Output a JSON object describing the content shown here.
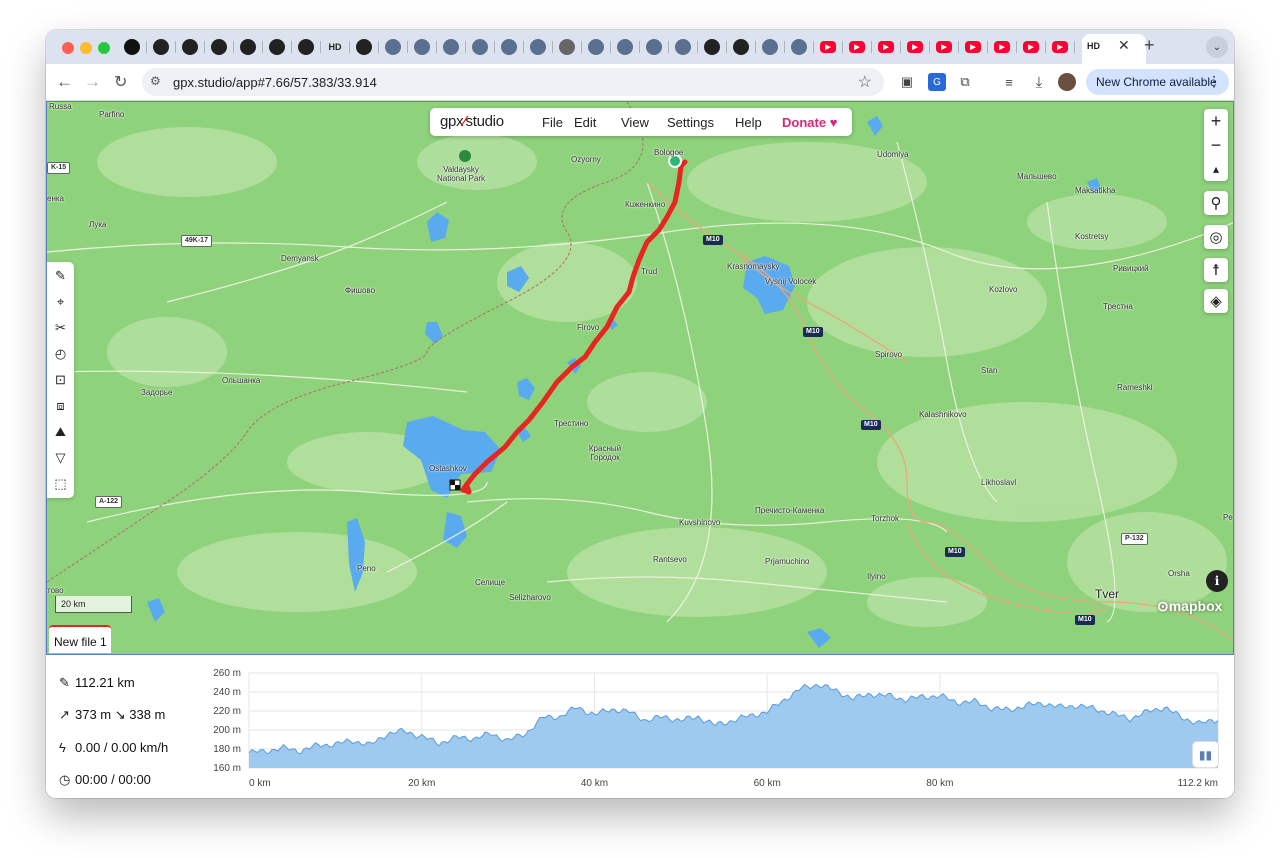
{
  "browser": {
    "url": "gpx.studio/app#7.66/57.383/33.914",
    "active_tab_badge": "HD",
    "hd_badge": "HD",
    "update_button": "New Chrome available",
    "tab_icons": [
      "openai",
      "github",
      "github",
      "github",
      "github",
      "github",
      "github",
      "hd",
      "github",
      "app",
      "app",
      "app",
      "app",
      "app",
      "app",
      "wikipedia",
      "app",
      "app",
      "app",
      "app",
      "github",
      "github",
      "app",
      "app",
      "youtube",
      "youtube",
      "youtube",
      "youtube",
      "youtube",
      "youtube",
      "youtube",
      "youtube",
      "youtube",
      "hd"
    ]
  },
  "app": {
    "logo_left": "gpx",
    "logo_right": "studio",
    "menu": [
      "File",
      "Edit",
      "View",
      "Settings",
      "Help"
    ],
    "donate": "Donate",
    "new_file_tab": "New file 1",
    "scale_label": "20 km",
    "mapbox_label": "mapbox"
  },
  "map": {
    "places": [
      {
        "name": "Russa",
        "big": false
      },
      {
        "name": "Parfino",
        "big": false
      },
      {
        "name": "Valdaysky National Park",
        "big": false
      },
      {
        "name": "Ozyorny",
        "big": false
      },
      {
        "name": "Bologoe",
        "big": false
      },
      {
        "name": "Udomlya",
        "big": false
      },
      {
        "name": "Мальшево",
        "big": false
      },
      {
        "name": "Maksatikha",
        "big": false
      },
      {
        "name": "Кuженкино",
        "big": false
      },
      {
        "name": "Лука",
        "big": false
      },
      {
        "name": "Demyansk",
        "big": false
      },
      {
        "name": "Фишово",
        "big": false
      },
      {
        "name": "Trud",
        "big": false
      },
      {
        "name": "Krasnomaysky",
        "big": false
      },
      {
        "name": "Vysnij Volocek",
        "big": false
      },
      {
        "name": "Kostretsy",
        "big": false
      },
      {
        "name": "Ривицкий",
        "big": false
      },
      {
        "name": "Kozlovo",
        "big": false
      },
      {
        "name": "Трестна",
        "big": false
      },
      {
        "name": "Firovo",
        "big": false
      },
      {
        "name": "Spirovo",
        "big": false
      },
      {
        "name": "Stan",
        "big": false
      },
      {
        "name": "Ольшанка",
        "big": false
      },
      {
        "name": "Задорье",
        "big": false
      },
      {
        "name": "Rameshki",
        "big": false
      },
      {
        "name": "Трестино",
        "big": false
      },
      {
        "name": "Kalashnikovo",
        "big": false
      },
      {
        "name": "Красный Городок",
        "big": false
      },
      {
        "name": "Ostashkov",
        "big": false
      },
      {
        "name": "Likhoslavl",
        "big": false
      },
      {
        "name": "Kuvshinovo",
        "big": false
      },
      {
        "name": "Пречисто-Каменка",
        "big": false
      },
      {
        "name": "Torzhok",
        "big": false
      },
      {
        "name": "Rantsevo",
        "big": false
      },
      {
        "name": "Prjamuchino",
        "big": false
      },
      {
        "name": "Ilyino",
        "big": false
      },
      {
        "name": "Peno",
        "big": false
      },
      {
        "name": "Селище",
        "big": false
      },
      {
        "name": "Selizharovo",
        "big": false
      },
      {
        "name": "Orsha",
        "big": false
      },
      {
        "name": "Tver",
        "big": true
      },
      {
        "name": "тово",
        "big": false
      },
      {
        "name": "енка",
        "big": false
      },
      {
        "name": "Pe",
        "big": false
      }
    ],
    "road_shields": [
      "K-15",
      "49K-17",
      "M10",
      "M10",
      "M10",
      "M10",
      "A-122",
      "P-132",
      "M10"
    ]
  },
  "stats": {
    "distance": "112.21 km",
    "elevation": "373 m ↘ 338 m",
    "speed": "0.00 / 0.00 km/h",
    "time": "00:00 / 00:00"
  },
  "chart_data": {
    "type": "area",
    "title": "",
    "xlabel": "",
    "ylabel": "",
    "x_ticks": [
      "0 km",
      "20 km",
      "40 km",
      "60 km",
      "80 km",
      "112.2 km"
    ],
    "y_ticks": [
      "260 m",
      "240 m",
      "220 m",
      "200 m",
      "180 m",
      "160 m"
    ],
    "ylim": [
      160,
      260
    ],
    "xlim": [
      0,
      112.2
    ],
    "grid": true,
    "fill_color": "#9fcaf0",
    "line_color": "#5a9ad8",
    "points": [
      [
        0,
        176
      ],
      [
        2,
        178
      ],
      [
        4,
        181
      ],
      [
        6,
        178
      ],
      [
        8,
        184
      ],
      [
        10,
        185
      ],
      [
        12,
        189
      ],
      [
        14,
        184
      ],
      [
        16,
        196
      ],
      [
        18,
        199
      ],
      [
        20,
        193
      ],
      [
        22,
        186
      ],
      [
        24,
        192
      ],
      [
        26,
        191
      ],
      [
        28,
        196
      ],
      [
        30,
        189
      ],
      [
        32,
        196
      ],
      [
        34,
        213
      ],
      [
        36,
        214
      ],
      [
        38,
        224
      ],
      [
        40,
        216
      ],
      [
        42,
        222
      ],
      [
        44,
        219
      ],
      [
        46,
        210
      ],
      [
        48,
        214
      ],
      [
        50,
        210
      ],
      [
        52,
        214
      ],
      [
        54,
        205
      ],
      [
        56,
        210
      ],
      [
        58,
        215
      ],
      [
        60,
        219
      ],
      [
        62,
        232
      ],
      [
        64,
        244
      ],
      [
        66,
        248
      ],
      [
        68,
        241
      ],
      [
        70,
        233
      ],
      [
        72,
        238
      ],
      [
        74,
        236
      ],
      [
        76,
        232
      ],
      [
        78,
        235
      ],
      [
        80,
        236
      ],
      [
        82,
        229
      ],
      [
        84,
        230
      ],
      [
        86,
        223
      ],
      [
        88,
        221
      ],
      [
        90,
        226
      ],
      [
        92,
        228
      ],
      [
        94,
        224
      ],
      [
        96,
        226
      ],
      [
        98,
        222
      ],
      [
        100,
        217
      ],
      [
        102,
        212
      ],
      [
        104,
        219
      ],
      [
        106,
        224
      ],
      [
        108,
        213
      ],
      [
        110,
        207
      ],
      [
        112.2,
        210
      ]
    ]
  }
}
